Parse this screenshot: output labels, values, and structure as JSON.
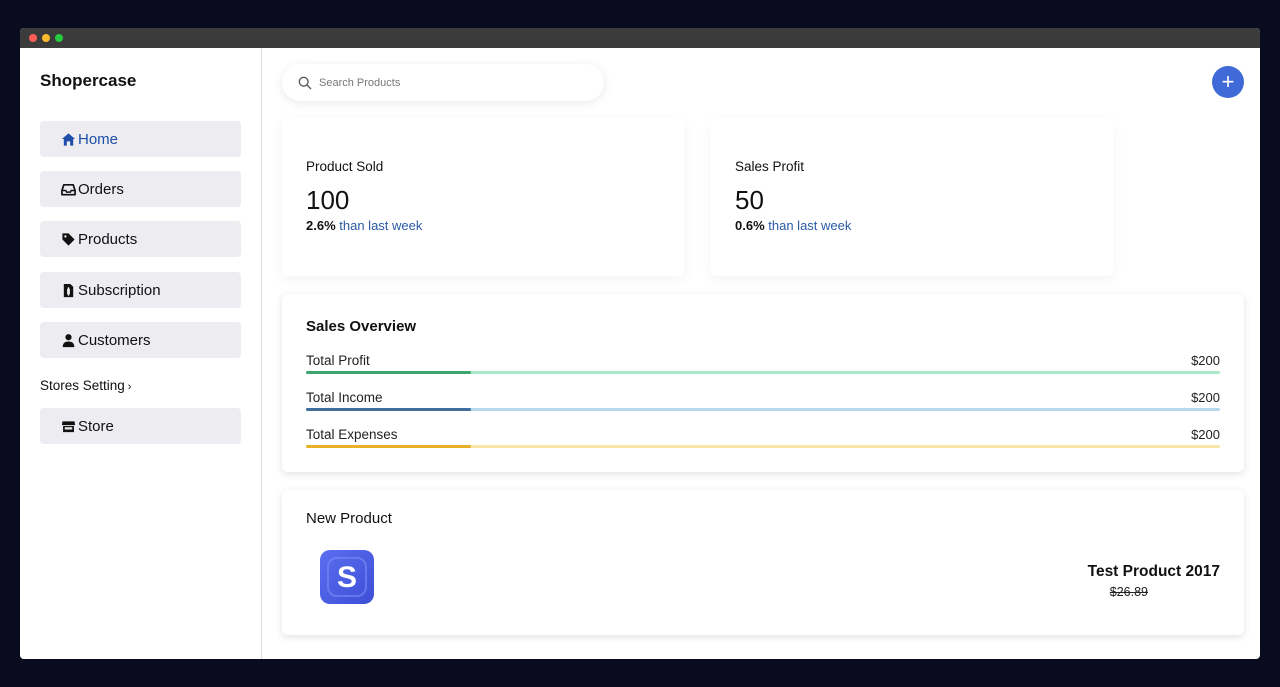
{
  "app": {
    "brand": "Shopercase"
  },
  "sidebar": {
    "items": [
      {
        "label": "Home",
        "icon": "home-icon",
        "active": true
      },
      {
        "label": "Orders",
        "icon": "inbox-icon",
        "active": false
      },
      {
        "label": "Products",
        "icon": "tag-icon",
        "active": false
      },
      {
        "label": "Subscription",
        "icon": "file-invoice-icon",
        "active": false
      },
      {
        "label": "Customers",
        "icon": "user-icon",
        "active": false
      }
    ],
    "section_label": "Stores Setting",
    "section_chevron": "›",
    "store_item": {
      "label": "Store",
      "icon": "store-icon"
    }
  },
  "search": {
    "placeholder": "Search Products",
    "value": ""
  },
  "add_button": {
    "label": "+",
    "icon": "plus-icon"
  },
  "stats": [
    {
      "label": "Product Sold",
      "value": "100",
      "delta": "2.6%",
      "delta_text": "than last week"
    },
    {
      "label": "Sales Profit",
      "value": "50",
      "delta": "0.6%",
      "delta_text": "than last week"
    }
  ],
  "overview": {
    "title": "Sales Overview",
    "rows": [
      {
        "name": "Total Profit",
        "amount": "$200",
        "fill_fraction": 0.18,
        "color": "#3fa56e",
        "track_color": "#a9e8c8"
      },
      {
        "name": "Total Income",
        "amount": "$200",
        "fill_fraction": 0.18,
        "color": "#3f6f9f",
        "track_color": "#b5d8ec"
      },
      {
        "name": "Total Expenses",
        "amount": "$200",
        "fill_fraction": 0.18,
        "color": "#e8b12a",
        "track_color": "#f7e6a8"
      }
    ]
  },
  "new_product": {
    "title": "New Product",
    "logo_letter": "S",
    "name": "Test Product 2017",
    "price": "$26.89"
  },
  "colors": {
    "accent": "#3f6ad8",
    "link": "#2a5aa6",
    "active_nav": "#1e4ea8"
  }
}
